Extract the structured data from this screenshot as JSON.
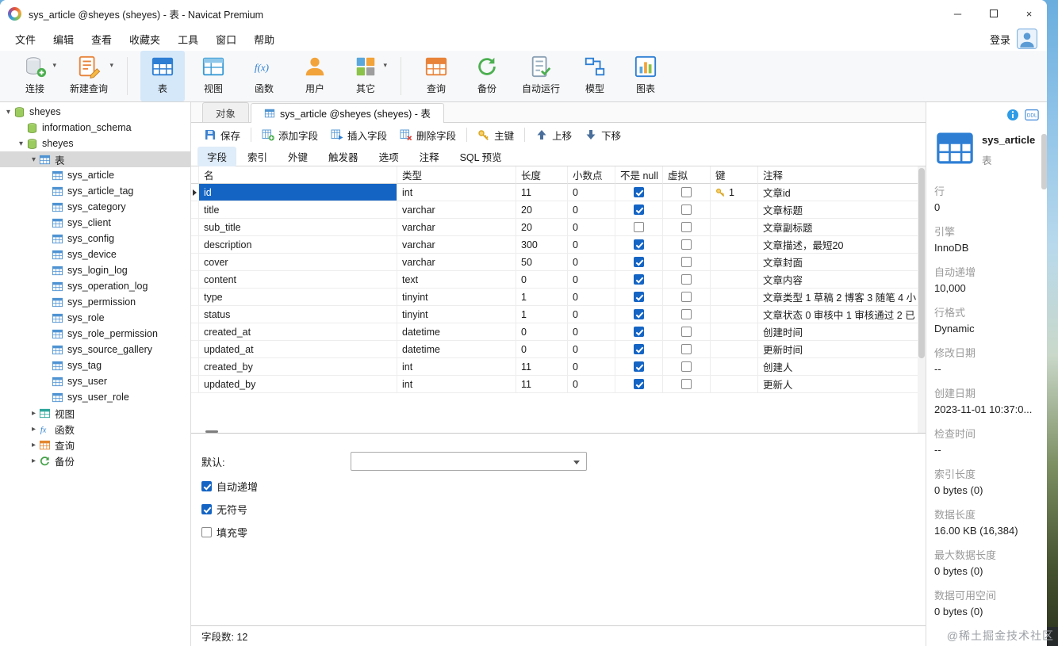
{
  "window": {
    "title": "sys_article @sheyes (sheyes) - 表 - Navicat Premium"
  },
  "menubar": {
    "items": [
      "文件",
      "编辑",
      "查看",
      "收藏夹",
      "工具",
      "窗口",
      "帮助"
    ],
    "login_label": "登录"
  },
  "toolbar": {
    "items": [
      {
        "icon": "connect",
        "label": "连接",
        "dropdown": true,
        "active": false
      },
      {
        "icon": "new-query",
        "label": "新建查询",
        "dropdown": true,
        "active": false
      },
      {
        "icon": "table",
        "label": "表",
        "dropdown": false,
        "active": true
      },
      {
        "icon": "view",
        "label": "视图",
        "dropdown": false,
        "active": false
      },
      {
        "icon": "function",
        "label": "函数",
        "dropdown": false,
        "active": false
      },
      {
        "icon": "user",
        "label": "用户",
        "dropdown": false,
        "active": false
      },
      {
        "icon": "other",
        "label": "其它",
        "dropdown": true,
        "active": false
      },
      {
        "icon": "query",
        "label": "查询",
        "dropdown": false,
        "active": false
      },
      {
        "icon": "backup",
        "label": "备份",
        "dropdown": false,
        "active": false
      },
      {
        "icon": "automation",
        "label": "自动运行",
        "dropdown": false,
        "active": false
      },
      {
        "icon": "model",
        "label": "模型",
        "dropdown": false,
        "active": false
      },
      {
        "icon": "chart",
        "label": "图表",
        "dropdown": false,
        "active": false
      }
    ]
  },
  "sidebar": {
    "tree": [
      {
        "label": "sheyes",
        "icon": "db",
        "level": 0,
        "arrow": "down",
        "selected": false
      },
      {
        "label": "information_schema",
        "icon": "db",
        "level": 1,
        "arrow": "none",
        "selected": false
      },
      {
        "label": "sheyes",
        "icon": "db",
        "level": 1,
        "arrow": "down",
        "selected": false
      },
      {
        "label": "表",
        "icon": "table",
        "level": 2,
        "arrow": "down",
        "selected": true
      },
      {
        "label": "sys_article",
        "icon": "table",
        "level": 3,
        "arrow": "none",
        "selected": false
      },
      {
        "label": "sys_article_tag",
        "icon": "table",
        "level": 3,
        "arrow": "none",
        "selected": false
      },
      {
        "label": "sys_category",
        "icon": "table",
        "level": 3,
        "arrow": "none",
        "selected": false
      },
      {
        "label": "sys_client",
        "icon": "table",
        "level": 3,
        "arrow": "none",
        "selected": false
      },
      {
        "label": "sys_config",
        "icon": "table",
        "level": 3,
        "arrow": "none",
        "selected": false
      },
      {
        "label": "sys_device",
        "icon": "table",
        "level": 3,
        "arrow": "none",
        "selected": false
      },
      {
        "label": "sys_login_log",
        "icon": "table",
        "level": 3,
        "arrow": "none",
        "selected": false
      },
      {
        "label": "sys_operation_log",
        "icon": "table",
        "level": 3,
        "arrow": "none",
        "selected": false
      },
      {
        "label": "sys_permission",
        "icon": "table",
        "level": 3,
        "arrow": "none",
        "selected": false
      },
      {
        "label": "sys_role",
        "icon": "table",
        "level": 3,
        "arrow": "none",
        "selected": false
      },
      {
        "label": "sys_role_permission",
        "icon": "table",
        "level": 3,
        "arrow": "none",
        "selected": false
      },
      {
        "label": "sys_source_gallery",
        "icon": "table",
        "level": 3,
        "arrow": "none",
        "selected": false
      },
      {
        "label": "sys_tag",
        "icon": "table",
        "level": 3,
        "arrow": "none",
        "selected": false
      },
      {
        "label": "sys_user",
        "icon": "table",
        "level": 3,
        "arrow": "none",
        "selected": false
      },
      {
        "label": "sys_user_role",
        "icon": "table",
        "level": 3,
        "arrow": "none",
        "selected": false
      },
      {
        "label": "视图",
        "icon": "view",
        "level": 2,
        "arrow": "right",
        "selected": false
      },
      {
        "label": "函数",
        "icon": "function",
        "level": 2,
        "arrow": "right",
        "selected": false
      },
      {
        "label": "查询",
        "icon": "query",
        "level": 2,
        "arrow": "right",
        "selected": false
      },
      {
        "label": "备份",
        "icon": "backup",
        "level": 2,
        "arrow": "right",
        "selected": false
      }
    ]
  },
  "tabs": {
    "object_tab": "对象",
    "active_tab": "sys_article @sheyes (sheyes) - 表"
  },
  "edit_toolbar": {
    "save": "保存",
    "add_field": "添加字段",
    "insert_field": "插入字段",
    "delete_field": "删除字段",
    "primary_key": "主键",
    "move_up": "上移",
    "move_down": "下移"
  },
  "subtabs": {
    "items": [
      "字段",
      "索引",
      "外键",
      "触发器",
      "选项",
      "注释",
      "SQL 预览"
    ],
    "active_index": 0
  },
  "grid": {
    "columns": [
      "名",
      "类型",
      "长度",
      "小数点",
      "不是 null",
      "虚拟",
      "键",
      "注释"
    ],
    "rows": [
      {
        "name": "id",
        "type": "int",
        "length": "11",
        "decimal": "0",
        "not_null": true,
        "virtual": false,
        "key": "1",
        "comment": "文章id",
        "selected": true
      },
      {
        "name": "title",
        "type": "varchar",
        "length": "20",
        "decimal": "0",
        "not_null": true,
        "virtual": false,
        "key": "",
        "comment": "文章标题",
        "selected": false
      },
      {
        "name": "sub_title",
        "type": "varchar",
        "length": "20",
        "decimal": "0",
        "not_null": false,
        "virtual": false,
        "key": "",
        "comment": "文章副标题",
        "selected": false
      },
      {
        "name": "description",
        "type": "varchar",
        "length": "300",
        "decimal": "0",
        "not_null": true,
        "virtual": false,
        "key": "",
        "comment": "文章描述，最短20",
        "selected": false
      },
      {
        "name": "cover",
        "type": "varchar",
        "length": "50",
        "decimal": "0",
        "not_null": true,
        "virtual": false,
        "key": "",
        "comment": "文章封面",
        "selected": false
      },
      {
        "name": "content",
        "type": "text",
        "length": "0",
        "decimal": "0",
        "not_null": true,
        "virtual": false,
        "key": "",
        "comment": "文章内容",
        "selected": false
      },
      {
        "name": "type",
        "type": "tinyint",
        "length": "1",
        "decimal": "0",
        "not_null": true,
        "virtual": false,
        "key": "",
        "comment": "文章类型 1 草稿 2 博客 3 随笔 4 小",
        "selected": false
      },
      {
        "name": "status",
        "type": "tinyint",
        "length": "1",
        "decimal": "0",
        "not_null": true,
        "virtual": false,
        "key": "",
        "comment": "文章状态 0 审核中 1 审核通过 2 已",
        "selected": false
      },
      {
        "name": "created_at",
        "type": "datetime",
        "length": "0",
        "decimal": "0",
        "not_null": true,
        "virtual": false,
        "key": "",
        "comment": "创建时间",
        "selected": false
      },
      {
        "name": "updated_at",
        "type": "datetime",
        "length": "0",
        "decimal": "0",
        "not_null": true,
        "virtual": false,
        "key": "",
        "comment": "更新时间",
        "selected": false
      },
      {
        "name": "created_by",
        "type": "int",
        "length": "11",
        "decimal": "0",
        "not_null": true,
        "virtual": false,
        "key": "",
        "comment": "创建人",
        "selected": false
      },
      {
        "name": "updated_by",
        "type": "int",
        "length": "11",
        "decimal": "0",
        "not_null": true,
        "virtual": false,
        "key": "",
        "comment": "更新人",
        "selected": false
      }
    ]
  },
  "field_props": {
    "default_label": "默认:",
    "default_value": "",
    "checkboxes": [
      {
        "label": "自动递增",
        "checked": true
      },
      {
        "label": "无符号",
        "checked": true
      },
      {
        "label": "填充零",
        "checked": false
      }
    ]
  },
  "statusbar": {
    "text": "字段数: 12"
  },
  "info_panel": {
    "ddl_label": "DDL",
    "title": "sys_article",
    "subtitle": "表",
    "properties": [
      {
        "label": "行",
        "value": "0"
      },
      {
        "label": "引擎",
        "value": "InnoDB"
      },
      {
        "label": "自动递增",
        "value": "10,000"
      },
      {
        "label": "行格式",
        "value": "Dynamic"
      },
      {
        "label": "修改日期",
        "value": "--"
      },
      {
        "label": "创建日期",
        "value": "2023-11-01 10:37:0..."
      },
      {
        "label": "检查时间",
        "value": "--"
      },
      {
        "label": "索引长度",
        "value": "0 bytes (0)"
      },
      {
        "label": "数据长度",
        "value": "16.00 KB (16,384)"
      },
      {
        "label": "最大数据长度",
        "value": "0 bytes (0)"
      },
      {
        "label": "数据可用空间",
        "value": "0 bytes (0)"
      }
    ]
  },
  "watermark": "@稀土掘金技术社区"
}
